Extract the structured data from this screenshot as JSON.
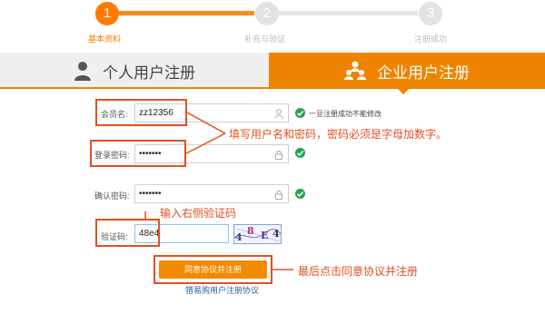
{
  "progress": {
    "steps": [
      {
        "number": "1",
        "label": "基本资料",
        "state": "active"
      },
      {
        "number": "2",
        "label": "补充与验证",
        "state": "pending"
      },
      {
        "number": "3",
        "label": "注册成功",
        "state": "pending"
      }
    ],
    "active_color": "#ff7a00",
    "inactive_color": "#e3e3e3"
  },
  "tabs": {
    "personal": {
      "label": "个人用户注册",
      "icon": "person-icon"
    },
    "enterprise": {
      "label": "企业用户注册",
      "icon": "organization-icon",
      "selected": true
    }
  },
  "form": {
    "username": {
      "label": "会员名:",
      "value": "zz12356",
      "hint": "一旦注册成功不能修改",
      "icon": "user-icon"
    },
    "password": {
      "label": "登录密码:",
      "value": "•••••••",
      "icon": "lock-icon"
    },
    "confirm_password": {
      "label": "确认密码:",
      "value": "•••••••",
      "icon": "lock-icon"
    },
    "captcha": {
      "label": "验证码:",
      "value": "48e4",
      "image_chars": [
        "4",
        "8",
        "E",
        "4"
      ]
    },
    "submit_label": "同意协议并注册",
    "agreement_link": "猎易购用户注册协议"
  },
  "annotations": {
    "credentials_note": "填写用户名和密码，密码必须是字母加数字。",
    "captcha_note": "输入右侧验证码",
    "submit_note": "最后点击同意协议并注册",
    "color": "#e2501e"
  },
  "colors": {
    "accent": "#f08300",
    "valid": "#27a34a",
    "link": "#2a5f9e"
  }
}
